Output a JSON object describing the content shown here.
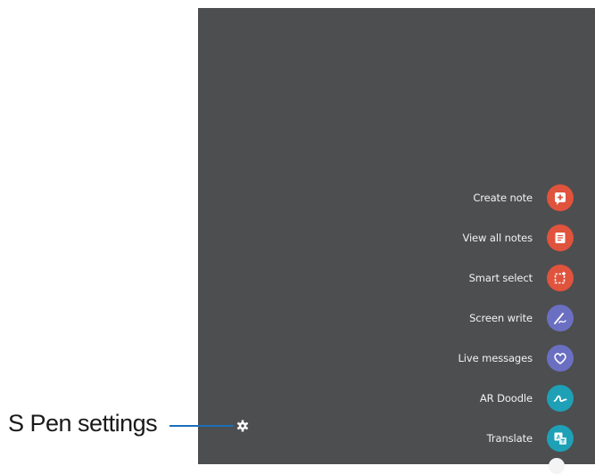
{
  "air_command": {
    "items": [
      {
        "label": "Create note",
        "icon": "create-note-icon",
        "color": "#e0533d"
      },
      {
        "label": "View all notes",
        "icon": "view-notes-icon",
        "color": "#e0533d"
      },
      {
        "label": "Smart select",
        "icon": "smart-select-icon",
        "color": "#e0533d"
      },
      {
        "label": "Screen write",
        "icon": "screen-write-icon",
        "color": "#6b6fc2"
      },
      {
        "label": "Live messages",
        "icon": "heart-icon",
        "color": "#6b6fc2"
      },
      {
        "label": "AR Doodle",
        "icon": "doodle-icon",
        "color": "#1ea0b6"
      },
      {
        "label": "Translate",
        "icon": "translate-icon",
        "color": "#1ea0b6"
      }
    ],
    "settings_icon": "gear-icon"
  },
  "callout": {
    "label": "S Pen settings",
    "line_color": "#1b6fb8"
  },
  "screen_color": "#4d4e50"
}
